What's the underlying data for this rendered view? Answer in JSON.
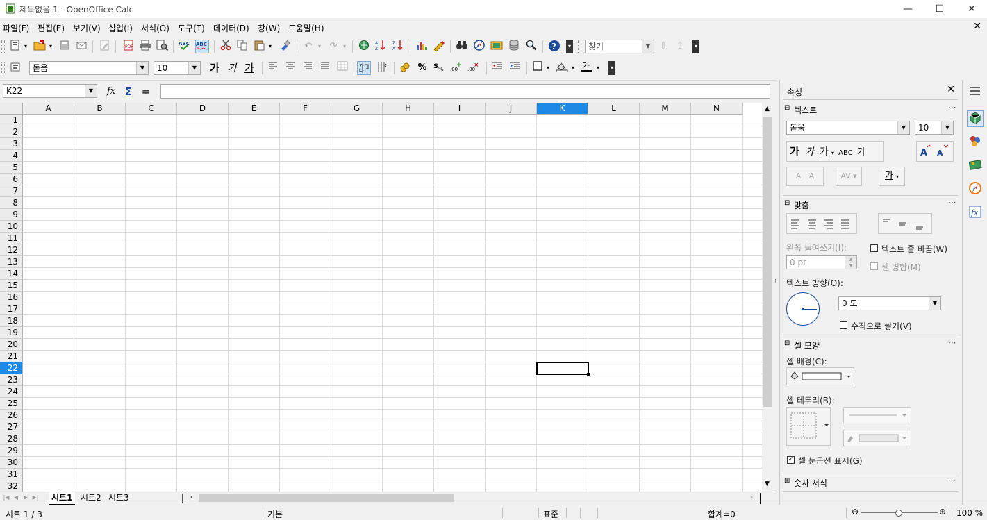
{
  "window": {
    "title": "제목없음 1 - OpenOffice Calc",
    "minimize": "—",
    "maximize": "☐",
    "close": "✕"
  },
  "menu": {
    "items": [
      "파일(F)",
      "편집(E)",
      "보기(V)",
      "삽입(I)",
      "서식(O)",
      "도구(T)",
      "데이터(D)",
      "창(W)",
      "도움말(H)"
    ],
    "close": "✕"
  },
  "toolbar": {
    "find_placeholder": "찾기"
  },
  "format_toolbar": {
    "font_name": "돋움",
    "font_size": "10",
    "bold": "가",
    "italic": "가",
    "underline": "가"
  },
  "formula_bar": {
    "name_box": "K22",
    "function_wizard": "fx",
    "sum": "Σ",
    "equals": "="
  },
  "grid": {
    "columns": [
      "A",
      "B",
      "C",
      "D",
      "E",
      "F",
      "G",
      "H",
      "I",
      "J",
      "K",
      "L",
      "M",
      "N"
    ],
    "rows": [
      "1",
      "2",
      "3",
      "4",
      "5",
      "6",
      "7",
      "8",
      "9",
      "10",
      "11",
      "12",
      "13",
      "14",
      "15",
      "16",
      "17",
      "18",
      "19",
      "20",
      "21",
      "22",
      "23",
      "24",
      "25",
      "26",
      "27",
      "28",
      "29",
      "30",
      "31",
      "32"
    ],
    "selected_cell": "K22"
  },
  "sheet_tabs": [
    "시트1",
    "시트2",
    "시트3"
  ],
  "status": {
    "sheet": "시트 1 / 3",
    "style": "기본",
    "mode": "표준",
    "sum": "합계=0",
    "zoom": "100 %"
  },
  "sidebar": {
    "title": "속성",
    "text_section": {
      "title": "텍스트",
      "font_name": "돋움",
      "font_size": "10"
    },
    "align_section": {
      "title": "맞춤",
      "indent_label": "왼쪽 들여쓰기(I):",
      "indent_value": "0 pt",
      "wrap_label": "텍스트 줄 바꿈(W)",
      "merge_label": "셀 병합(M)",
      "direction_label": "텍스트 방향(O):",
      "angle_value": "0 도",
      "stack_label": "수직으로 쌓기(V)"
    },
    "cell_section": {
      "title": "셀 모양",
      "bg_label": "셀 배경(C):",
      "border_label": "셀 테두리(B):",
      "gridlines_label": "셀 눈금선 표시(G)"
    },
    "number_section": {
      "title": "숫자 서식"
    }
  },
  "colors": {
    "accent": "#1e88e5",
    "cursor": "#000000"
  }
}
